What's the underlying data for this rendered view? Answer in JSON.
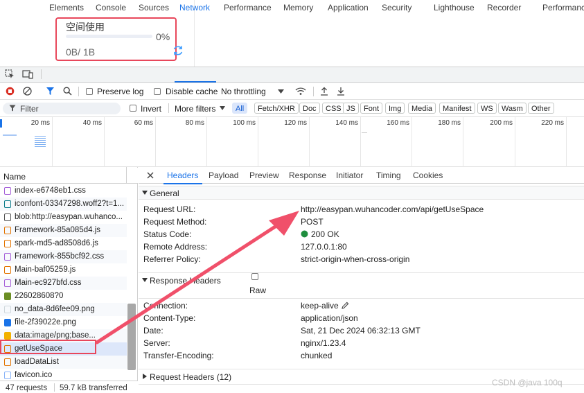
{
  "app": {
    "space_title": "空间使用",
    "space_percent": "0%",
    "space_fraction": 0.0,
    "space_usage": "0B/ 1B"
  },
  "devtools": {
    "tabs": [
      "Elements",
      "Console",
      "Sources",
      "Network",
      "Performance",
      "Memory",
      "Application",
      "Security",
      "Lighthouse",
      "Recorder",
      "Performanc"
    ],
    "active_tab": "Network",
    "toolbar": {
      "preserve_log": "Preserve log",
      "disable_cache": "Disable cache",
      "throttling": "No throttling"
    },
    "filter": {
      "placeholder": "Filter",
      "invert": "Invert",
      "more_filters": "More filters",
      "chips": [
        "All",
        "Fetch/XHR",
        "Doc",
        "CSS",
        "JS",
        "Font",
        "Img",
        "Media",
        "Manifest",
        "WS",
        "Wasm",
        "Other"
      ],
      "active_chip": "All"
    },
    "timeline": {
      "ticks": [
        "20 ms",
        "40 ms",
        "60 ms",
        "80 ms",
        "100 ms",
        "120 ms",
        "140 ms",
        "160 ms",
        "180 ms",
        "200 ms",
        "220 ms"
      ]
    },
    "requests": {
      "column": "Name",
      "items": [
        {
          "name": "index-e6748eb1.css",
          "type": "css"
        },
        {
          "name": "iconfont-03347298.woff2?t=1...",
          "type": "font"
        },
        {
          "name": "blob:http://easypan.wuhanco...",
          "type": "doc"
        },
        {
          "name": "Framework-85a085d4.js",
          "type": "js"
        },
        {
          "name": "spark-md5-ad8508d6.js",
          "type": "js"
        },
        {
          "name": "Framework-855bcf92.css",
          "type": "css"
        },
        {
          "name": "Main-baf05259.js",
          "type": "js"
        },
        {
          "name": "Main-ec927bfd.css",
          "type": "css"
        },
        {
          "name": "226028608?0",
          "type": "img"
        },
        {
          "name": "no_data-8d6fee09.png",
          "type": "img-light"
        },
        {
          "name": "file-2f39022e.png",
          "type": "img-blue"
        },
        {
          "name": "data:image/png;base...",
          "type": "folder"
        },
        {
          "name": "getUseSpace",
          "type": "xhr"
        },
        {
          "name": "loadDataList",
          "type": "xhr"
        },
        {
          "name": "favicon.ico",
          "type": "ico"
        }
      ],
      "selected": "getUseSpace",
      "requests_count": "47 requests",
      "transferred": "59.7 kB transferred"
    },
    "details": {
      "tabs": [
        "Headers",
        "Payload",
        "Preview",
        "Response",
        "Initiator",
        "Timing",
        "Cookies"
      ],
      "active_tab": "Headers",
      "general_title": "General",
      "general": [
        {
          "key": "Request URL:",
          "value": "http://easypan.wuhancoder.com/api/getUseSpace"
        },
        {
          "key": "Request Method:",
          "value": "POST"
        },
        {
          "key": "Status Code:",
          "value": "200 OK"
        },
        {
          "key": "Remote Address:",
          "value": "127.0.0.1:80"
        },
        {
          "key": "Referrer Policy:",
          "value": "strict-origin-when-cross-origin"
        }
      ],
      "response_headers_title": "Response Headers",
      "raw_label": "Raw",
      "response_headers": [
        {
          "key": "Connection:",
          "value": "keep-alive"
        },
        {
          "key": "Content-Type:",
          "value": "application/json"
        },
        {
          "key": "Date:",
          "value": "Sat, 21 Dec 2024 06:32:13 GMT"
        },
        {
          "key": "Server:",
          "value": "nginx/1.23.4"
        },
        {
          "key": "Transfer-Encoding:",
          "value": "chunked"
        }
      ],
      "request_headers_title": "Request Headers (12)"
    }
  },
  "watermark": "CSDN @java 100q",
  "colors": {
    "accent": "#1a73e8",
    "highlight": "#e8475b",
    "status_ok": "#1e8e3e"
  }
}
